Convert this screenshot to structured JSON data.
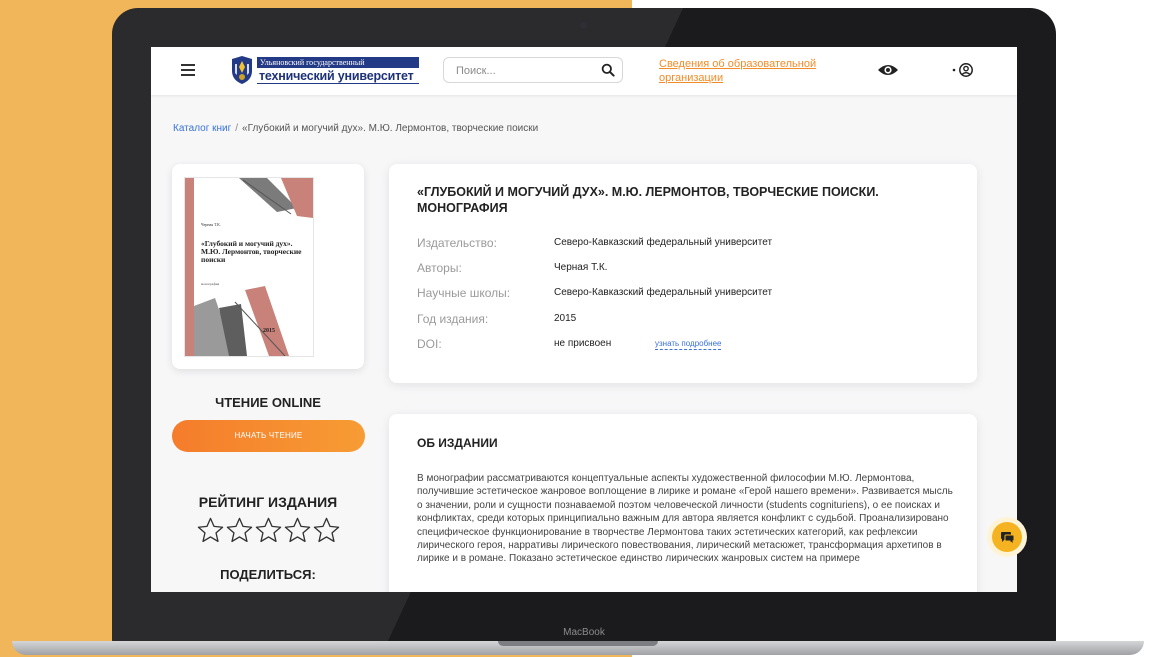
{
  "device": {
    "brand": "MacBook"
  },
  "header": {
    "logo": {
      "line1": "Ульяновский государственный",
      "line2": "технический университет"
    },
    "search": {
      "placeholder": "Поиск..."
    },
    "info_link": "Сведения об образовательной организации",
    "icons": {
      "menu": "hamburger-icon",
      "search": "search-icon",
      "accessibility": "eye-icon",
      "account": "user-icon"
    }
  },
  "breadcrumb": {
    "root": "Каталог книг",
    "separator": "/",
    "current": "«Глубокий и могучий дух». М.Ю. Лермонтов, творческие поиски"
  },
  "cover": {
    "author": "Черная Т.К.",
    "title": "«Глубокий и могучий дух». М.Ю. Лермонтов, творческие поиски",
    "subtitle": "монография",
    "year": "2015",
    "accent_color": "#c9827a"
  },
  "reading": {
    "title": "ЧТЕНИЕ ONLINE",
    "button": "НАЧАТЬ ЧТЕНИЕ",
    "button_color": "#f5872d"
  },
  "rating": {
    "title": "РЕЙТИНГ ИЗДАНИЯ",
    "stars_max": 5,
    "stars_value": 0
  },
  "share": {
    "title": "ПОДЕЛИТЬСЯ:"
  },
  "book": {
    "title": "«ГЛУБОКИЙ И МОГУЧИЙ ДУХ». М.Ю. ЛЕРМОНТОВ, ТВОРЧЕСКИЕ ПОИСКИ. МОНОГРАФИЯ",
    "fields": [
      {
        "key": "Издательство:",
        "value": "Северо-Кавказский федеральный университет"
      },
      {
        "key": "Авторы:",
        "value": "Черная Т.К."
      },
      {
        "key": "Научные школы:",
        "value": "Северо-Кавказский федеральный университет"
      },
      {
        "key": "Год издания:",
        "value": "2015"
      },
      {
        "key": "DOI:",
        "value": "не присвоен",
        "link": "узнать подробнее"
      }
    ]
  },
  "about": {
    "title": "ОБ ИЗДАНИИ",
    "text": "В монографии рассматриваются концептуальные аспекты художественной философии М.Ю. Лермонтова, получившие эстетическое жанровое воплощение в лирике и романе «Герой нашего времени». Развивается мысль о значении, роли и сущности познаваемой поэтом человеческой личности (students cognituriens), о ее поисках и конфликтах, среди которых принципиально важным для автора является конфликт с судьбой. Проанализировано специфическое функционирование в творчестве Лермонтова таких эстетических категорий, как рефлексии лирического героя, нарративы лирического повествования, лирический метасюжет, трансформация архетипов в лирике и в романе. Показано эстетическое единство лирических жанровых систем на примере"
  },
  "chat": {
    "icon": "chat-icon",
    "color": "#f5b321"
  }
}
